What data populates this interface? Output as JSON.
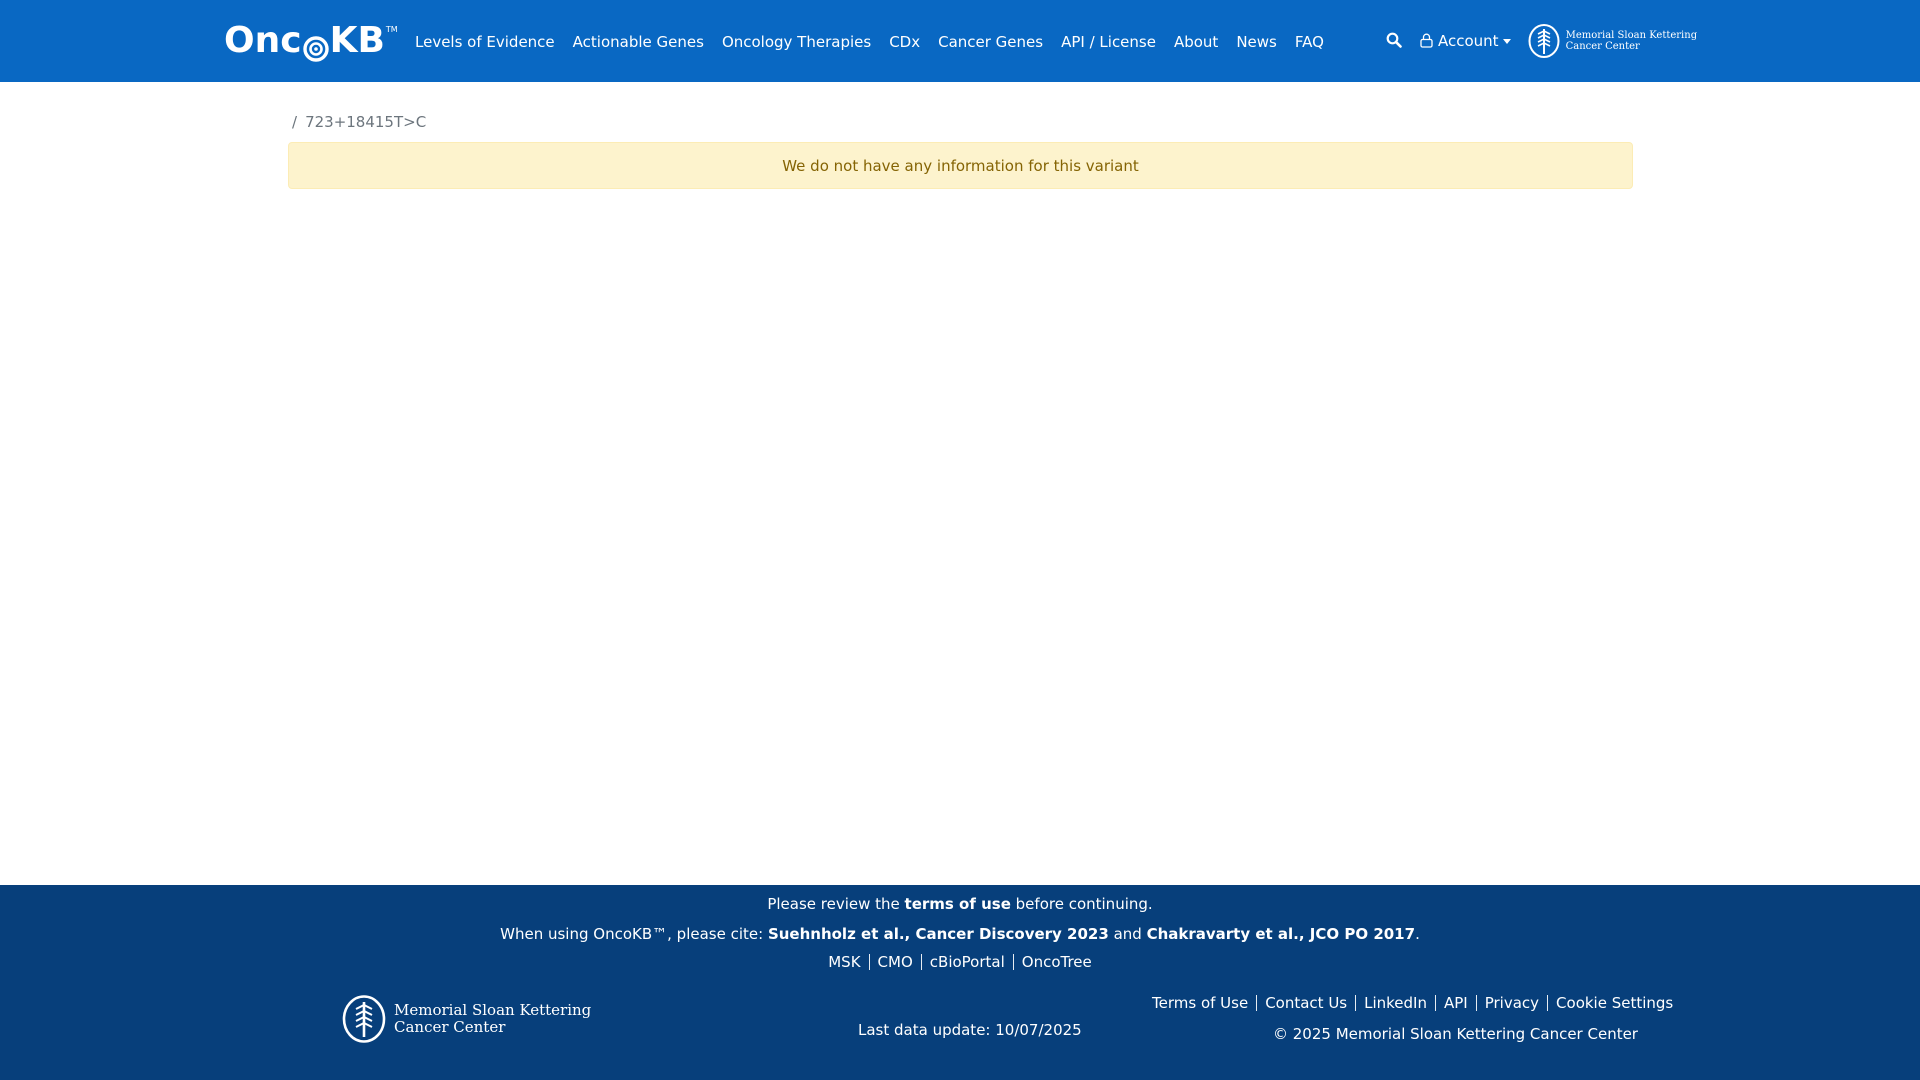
{
  "header": {
    "brand": {
      "text_a": "Onc",
      "text_b": "KB",
      "tm": "TM"
    },
    "nav": [
      {
        "label": "Levels of Evidence"
      },
      {
        "label": "Actionable Genes"
      },
      {
        "label": "Oncology Therapies"
      },
      {
        "label": "CDx"
      },
      {
        "label": "Cancer Genes"
      },
      {
        "label": "API / License"
      },
      {
        "label": "About"
      },
      {
        "label": "News"
      },
      {
        "label": "FAQ"
      }
    ],
    "account_label": "Account",
    "msk_line1": "Memorial Sloan Kettering",
    "msk_line2": "Cancer Center"
  },
  "main": {
    "breadcrumb_sep": "/",
    "breadcrumb_current": "723+18415T>C",
    "alert_text": "We do not have any information for this variant"
  },
  "footer": {
    "review_prefix": "Please review the ",
    "review_link": "terms of use",
    "review_suffix": " before continuing.",
    "cite_prefix": "When using OncoKB™, please cite: ",
    "cite_1": "Suehnholz et al., Cancer Discovery 2023",
    "cite_and": " and ",
    "cite_2": "Chakravarty et al., JCO PO 2017",
    "cite_end": ".",
    "links_center": [
      "MSK",
      "CMO",
      "cBioPortal",
      "OncoTree"
    ],
    "msk_line1": "Memorial Sloan Kettering",
    "msk_line2": "Cancer Center",
    "last_update": "Last data update: 10/07/2025",
    "links_right": [
      "Terms of Use",
      "Contact Us",
      "LinkedIn",
      "API",
      "Privacy",
      "Cookie Settings"
    ],
    "copyright": "© 2025 Memorial Sloan Kettering Cancer Center"
  },
  "colors": {
    "header_bg": "#0968c3",
    "footer_bg": "#073f7b",
    "alert_bg": "#fdf3cd",
    "alert_text": "#856404"
  }
}
